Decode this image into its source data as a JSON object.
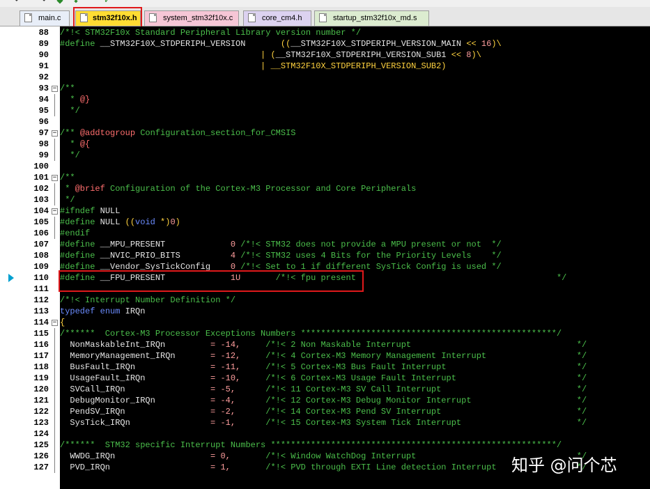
{
  "toolbar": {
    "icons": [
      "undo-icon",
      "redo-icon",
      "build-icon",
      "download-icon",
      "debug-icon"
    ]
  },
  "tabs": [
    {
      "label": "main.c",
      "color": "#e8eef8",
      "active": false
    },
    {
      "label": "stm32f10x.h",
      "color": "#ffdd33",
      "active": true
    },
    {
      "label": "system_stm32f10x.c",
      "color": "#f6c6d6",
      "active": false
    },
    {
      "label": "core_cm4.h",
      "color": "#dcd2f0",
      "active": false
    },
    {
      "label": "startup_stm32f10x_md.s",
      "color": "#dcecd0",
      "active": false
    }
  ],
  "watermark": "知乎 @问个芯",
  "highlight_color": "#e0191b",
  "current_line": "110",
  "lines": [
    {
      "num": "88",
      "fold": "",
      "seg": [
        [
          "/*!< STM32F10x Standard Peripheral Library version number */",
          "c"
        ]
      ]
    },
    {
      "num": "89",
      "fold": "",
      "seg": [
        [
          "#define",
          "c"
        ],
        [
          " __STM32F10X_STDPERIPH_VERSION       ",
          "t"
        ],
        [
          "((",
          "p"
        ],
        [
          "__STM32F10X_STDPERIPH_VERSION_MAIN ",
          "t"
        ],
        [
          "<<",
          "p"
        ],
        [
          " 16",
          "n"
        ],
        [
          ")\\",
          "p"
        ]
      ]
    },
    {
      "num": "90",
      "fold": "",
      "seg": [
        [
          "                                        ",
          "t"
        ],
        [
          "|",
          "p"
        ],
        [
          " (",
          "p"
        ],
        [
          "__STM32F10X_STDPERIPH_VERSION_SUB1 ",
          "t"
        ],
        [
          "<<",
          "p"
        ],
        [
          " 8",
          "n"
        ],
        [
          ")\\",
          "p"
        ]
      ]
    },
    {
      "num": "91",
      "fold": "",
      "seg": [
        [
          "                                        ",
          "t"
        ],
        [
          "|",
          "p"
        ],
        [
          " __STM32F10X_STDPERIPH_VERSION_SUB2)",
          "p"
        ]
      ]
    },
    {
      "num": "92",
      "fold": "",
      "seg": []
    },
    {
      "num": "93",
      "fold": "-",
      "seg": [
        [
          "/**",
          "c"
        ]
      ]
    },
    {
      "num": "94",
      "fold": "|",
      "seg": [
        [
          "  * ",
          "c"
        ],
        [
          "@}",
          "tag"
        ]
      ]
    },
    {
      "num": "95",
      "fold": "|",
      "seg": [
        [
          "  */",
          "c"
        ]
      ]
    },
    {
      "num": "96",
      "fold": "",
      "seg": []
    },
    {
      "num": "97",
      "fold": "-",
      "seg": [
        [
          "/** ",
          "c"
        ],
        [
          "@addtogroup",
          "tag"
        ],
        [
          " Configuration_section_for_CMSIS",
          "c"
        ]
      ]
    },
    {
      "num": "98",
      "fold": "|",
      "seg": [
        [
          "  * ",
          "c"
        ],
        [
          "@{",
          "tag"
        ]
      ]
    },
    {
      "num": "99",
      "fold": "|",
      "seg": [
        [
          "  */",
          "c"
        ]
      ]
    },
    {
      "num": "100",
      "fold": "",
      "seg": []
    },
    {
      "num": "101",
      "fold": "-",
      "seg": [
        [
          "/**",
          "c"
        ]
      ]
    },
    {
      "num": "102",
      "fold": "|",
      "seg": [
        [
          " * ",
          "c"
        ],
        [
          "@brief",
          "tag"
        ],
        [
          " Configuration of the Cortex-M3 Processor and Core Peripherals",
          "c"
        ]
      ]
    },
    {
      "num": "103",
      "fold": "|",
      "seg": [
        [
          " */",
          "c"
        ]
      ]
    },
    {
      "num": "104",
      "fold": "-",
      "seg": [
        [
          "#ifndef",
          "c"
        ],
        [
          " NULL",
          "t"
        ]
      ]
    },
    {
      "num": "105",
      "fold": "|",
      "seg": [
        [
          "#define",
          "c"
        ],
        [
          " NULL ",
          "t"
        ],
        [
          "((",
          "p"
        ],
        [
          "void",
          "k"
        ],
        [
          " *",
          "p"
        ],
        [
          ")",
          "p"
        ],
        [
          "0",
          "n"
        ],
        [
          ")",
          "p"
        ]
      ]
    },
    {
      "num": "106",
      "fold": "|",
      "seg": [
        [
          "#endif",
          "c"
        ]
      ]
    },
    {
      "num": "107",
      "fold": "",
      "seg": [
        [
          "#define",
          "c"
        ],
        [
          " __MPU_PRESENT             ",
          "t"
        ],
        [
          "0",
          "n"
        ],
        [
          " /*!< STM32 does not provide a MPU present or not  */",
          "c"
        ]
      ]
    },
    {
      "num": "108",
      "fold": "",
      "seg": [
        [
          "#define",
          "c"
        ],
        [
          " __NVIC_PRIO_BITS          ",
          "t"
        ],
        [
          "4",
          "n"
        ],
        [
          " /*!< STM32 uses 4 Bits for the Priority Levels    */",
          "c"
        ]
      ]
    },
    {
      "num": "109",
      "fold": "",
      "seg": [
        [
          "#define",
          "c"
        ],
        [
          " __Vendor_SysTickConfig    ",
          "t"
        ],
        [
          "0",
          "n"
        ],
        [
          " /*!< Set to 1 if different SysTick Config is used */",
          "c"
        ]
      ]
    },
    {
      "num": "110",
      "fold": "",
      "seg": [
        [
          "#define",
          "c"
        ],
        [
          " __FPU_PRESENT             ",
          "t"
        ],
        [
          "1U",
          "n"
        ],
        [
          "       /*!< fpu present                                        */",
          "c"
        ]
      ]
    },
    {
      "num": "111",
      "fold": "",
      "seg": []
    },
    {
      "num": "112",
      "fold": "",
      "seg": [
        [
          "/*!< Interrupt Number Definition */",
          "c"
        ]
      ]
    },
    {
      "num": "113",
      "fold": "",
      "seg": [
        [
          "typedef",
          "k"
        ],
        [
          " ",
          "t"
        ],
        [
          "enum",
          "k"
        ],
        [
          " IRQn",
          "t"
        ]
      ]
    },
    {
      "num": "114",
      "fold": "-",
      "seg": [
        [
          "{",
          "p"
        ]
      ]
    },
    {
      "num": "115",
      "fold": "|",
      "seg": [
        [
          "/******  Cortex-M3 Processor Exceptions Numbers ***************************************************/",
          "c"
        ]
      ]
    },
    {
      "num": "116",
      "fold": "|",
      "seg": [
        [
          "  NonMaskableInt_IRQn         ",
          "t"
        ],
        [
          "= -14,",
          "n"
        ],
        [
          "     /*!< 2 Non Maskable Interrupt                                 */",
          "c"
        ]
      ]
    },
    {
      "num": "117",
      "fold": "|",
      "seg": [
        [
          "  MemoryManagement_IRQn       ",
          "t"
        ],
        [
          "= -12,",
          "n"
        ],
        [
          "     /*!< 4 Cortex-M3 Memory Management Interrupt                  */",
          "c"
        ]
      ]
    },
    {
      "num": "118",
      "fold": "|",
      "seg": [
        [
          "  BusFault_IRQn               ",
          "t"
        ],
        [
          "= -11,",
          "n"
        ],
        [
          "     /*!< 5 Cortex-M3 Bus Fault Interrupt                          */",
          "c"
        ]
      ]
    },
    {
      "num": "119",
      "fold": "|",
      "seg": [
        [
          "  UsageFault_IRQn             ",
          "t"
        ],
        [
          "= -10,",
          "n"
        ],
        [
          "     /*!< 6 Cortex-M3 Usage Fault Interrupt                        */",
          "c"
        ]
      ]
    },
    {
      "num": "120",
      "fold": "|",
      "seg": [
        [
          "  SVCall_IRQn                 ",
          "t"
        ],
        [
          "= -5,",
          "n"
        ],
        [
          "      /*!< 11 Cortex-M3 SV Call Interrupt                           */",
          "c"
        ]
      ]
    },
    {
      "num": "121",
      "fold": "|",
      "seg": [
        [
          "  DebugMonitor_IRQn           ",
          "t"
        ],
        [
          "= -4,",
          "n"
        ],
        [
          "      /*!< 12 Cortex-M3 Debug Monitor Interrupt                     */",
          "c"
        ]
      ]
    },
    {
      "num": "122",
      "fold": "|",
      "seg": [
        [
          "  PendSV_IRQn                 ",
          "t"
        ],
        [
          "= -2,",
          "n"
        ],
        [
          "      /*!< 14 Cortex-M3 Pend SV Interrupt                           */",
          "c"
        ]
      ]
    },
    {
      "num": "123",
      "fold": "|",
      "seg": [
        [
          "  SysTick_IRQn                ",
          "t"
        ],
        [
          "= -1,",
          "n"
        ],
        [
          "      /*!< 15 Cortex-M3 System Tick Interrupt                       */",
          "c"
        ]
      ]
    },
    {
      "num": "124",
      "fold": "|",
      "seg": []
    },
    {
      "num": "125",
      "fold": "|",
      "seg": [
        [
          "/******  STM32 specific Interrupt Numbers *********************************************************/",
          "c"
        ]
      ]
    },
    {
      "num": "126",
      "fold": "|",
      "seg": [
        [
          "  WWDG_IRQn                   ",
          "t"
        ],
        [
          "= 0,",
          "n"
        ],
        [
          "       /*!< Window WatchDog Interrupt                                */",
          "c"
        ]
      ]
    },
    {
      "num": "127",
      "fold": "|",
      "seg": [
        [
          "  PVD_IRQn                    ",
          "t"
        ],
        [
          "= 1,",
          "n"
        ],
        [
          "       /*!< PVD through EXTI Line detection Interrupt                */",
          "c"
        ]
      ]
    }
  ]
}
